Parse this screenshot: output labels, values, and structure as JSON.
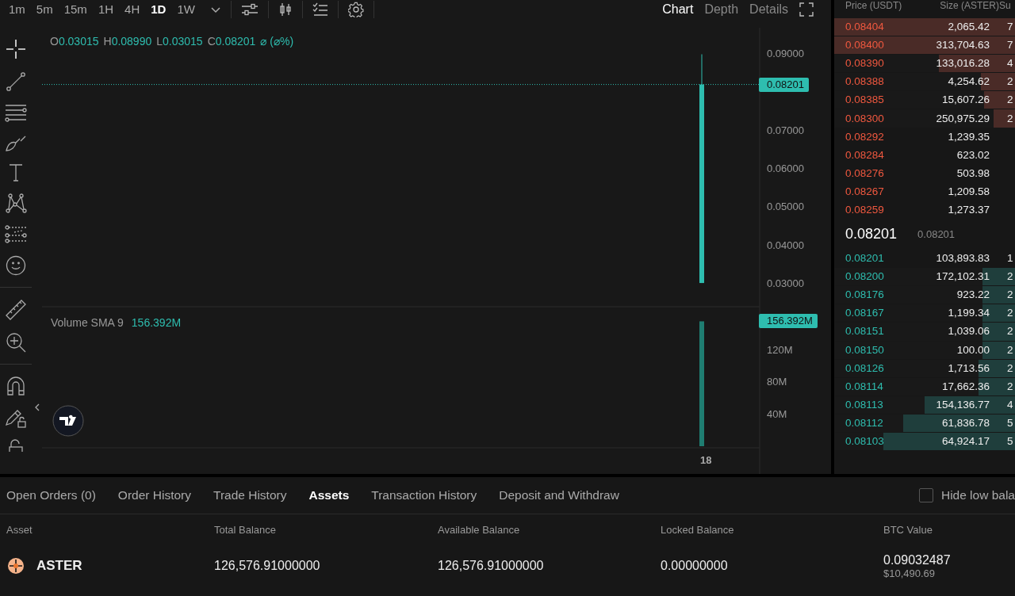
{
  "toolbar": {
    "intervals": [
      {
        "label": "1m",
        "selected": false
      },
      {
        "label": "5m",
        "selected": false
      },
      {
        "label": "15m",
        "selected": false
      },
      {
        "label": "1H",
        "selected": false
      },
      {
        "label": "4H",
        "selected": false
      },
      {
        "label": "1D",
        "selected": true
      },
      {
        "label": "1W",
        "selected": false
      }
    ],
    "views": [
      {
        "label": "Chart",
        "selected": true
      },
      {
        "label": "Depth",
        "selected": false
      },
      {
        "label": "Details",
        "selected": false
      }
    ]
  },
  "legend": {
    "ohlc": [
      {
        "label": "O",
        "value": "0.03015"
      },
      {
        "label": "H",
        "value": "0.08990"
      },
      {
        "label": "L",
        "value": "0.03015"
      },
      {
        "label": "C",
        "value": "0.08201"
      }
    ],
    "change": "⌀ (⌀%)"
  },
  "price_axis": {
    "ticks": [
      "0.09000",
      "0.07000",
      "0.06000",
      "0.05000",
      "0.04000",
      "0.03000"
    ],
    "last_price": "0.08201"
  },
  "volume": {
    "title": "Volume SMA 9",
    "value": "156.392M",
    "badge": "156.392M",
    "ticks": [
      "120M",
      "80M",
      "40M"
    ]
  },
  "time_axis": {
    "labels": [
      "18"
    ]
  },
  "order_book": {
    "columns": [
      "Price (USDT)",
      "Size (ASTER)",
      "Su"
    ],
    "asks": [
      {
        "price": "0.08404",
        "size": "2,065.42",
        "column_3": "7",
        "level": 1
      },
      {
        "price": "0.08400",
        "size": "313,704.63",
        "column_3": "7",
        "level": 1
      },
      {
        "price": "0.08390",
        "size": "133,016.28",
        "column_3": "4",
        "level": 0.42
      },
      {
        "price": "0.08388",
        "size": "4,254.62",
        "column_3": "2",
        "level": 0.19
      },
      {
        "price": "0.08385",
        "size": "15,607.26",
        "column_3": "2",
        "level": 0.17
      },
      {
        "price": "0.08300",
        "size": "250,975.29",
        "column_3": "2",
        "level": 0.12
      },
      {
        "price": "0.08292",
        "size": "1,239.35"
      },
      {
        "price": "0.08284",
        "size": "623.02"
      },
      {
        "price": "0.08276",
        "size": "503.98"
      },
      {
        "price": "0.08267",
        "size": "1,209.58"
      },
      {
        "price": "0.08259",
        "size": "1,273.37"
      }
    ],
    "mid": {
      "last": "0.08201",
      "mark": "0.08201"
    },
    "bids": [
      {
        "price": "0.08201",
        "size": "103,893.83",
        "column_3": "1"
      },
      {
        "price": "0.08200",
        "size": "172,102.31",
        "column_3": "2",
        "level": 0.18
      },
      {
        "price": "0.08176",
        "size": "923.22",
        "column_3": "2",
        "level": 0.18
      },
      {
        "price": "0.08167",
        "size": "1,199.34",
        "column_3": "2",
        "level": 0.18
      },
      {
        "price": "0.08151",
        "size": "1,039.06",
        "column_3": "2",
        "level": 0.18
      },
      {
        "price": "0.08150",
        "size": "100.00",
        "column_3": "2",
        "level": 0.18
      },
      {
        "price": "0.08126",
        "size": "1,713.56",
        "column_3": "2",
        "level": 0.2
      },
      {
        "price": "0.08114",
        "size": "17,662.36",
        "column_3": "2",
        "level": 0.2
      },
      {
        "price": "0.08113",
        "size": "154,136.77",
        "column_3": "4",
        "level": 0.5
      },
      {
        "price": "0.08112",
        "size": "61,836.78",
        "column_3": "5",
        "level": 0.62
      },
      {
        "price": "0.08103",
        "size": "64,924.17",
        "column_3": "5",
        "level": 0.73
      }
    ]
  },
  "bottom": {
    "tabs": [
      {
        "label": "Open Orders (0)",
        "selected": false
      },
      {
        "label": "Order History",
        "selected": false
      },
      {
        "label": "Trade History",
        "selected": false
      },
      {
        "label": "Assets",
        "selected": true
      },
      {
        "label": "Transaction History",
        "selected": false
      },
      {
        "label": "Deposit and Withdraw",
        "selected": false
      }
    ],
    "hide_low_balance": {
      "label": "Hide low bala",
      "checked": false
    },
    "columns": [
      "Asset",
      "Total Balance",
      "Available Balance",
      "Locked Balance",
      "BTC Value"
    ],
    "rows": [
      {
        "asset": "ASTER",
        "total": "126,576.91000000",
        "available": "126,576.91000000",
        "locked": "0.00000000",
        "btc_value": "0.09032487",
        "usd_value": "$10,490.69"
      }
    ]
  }
}
